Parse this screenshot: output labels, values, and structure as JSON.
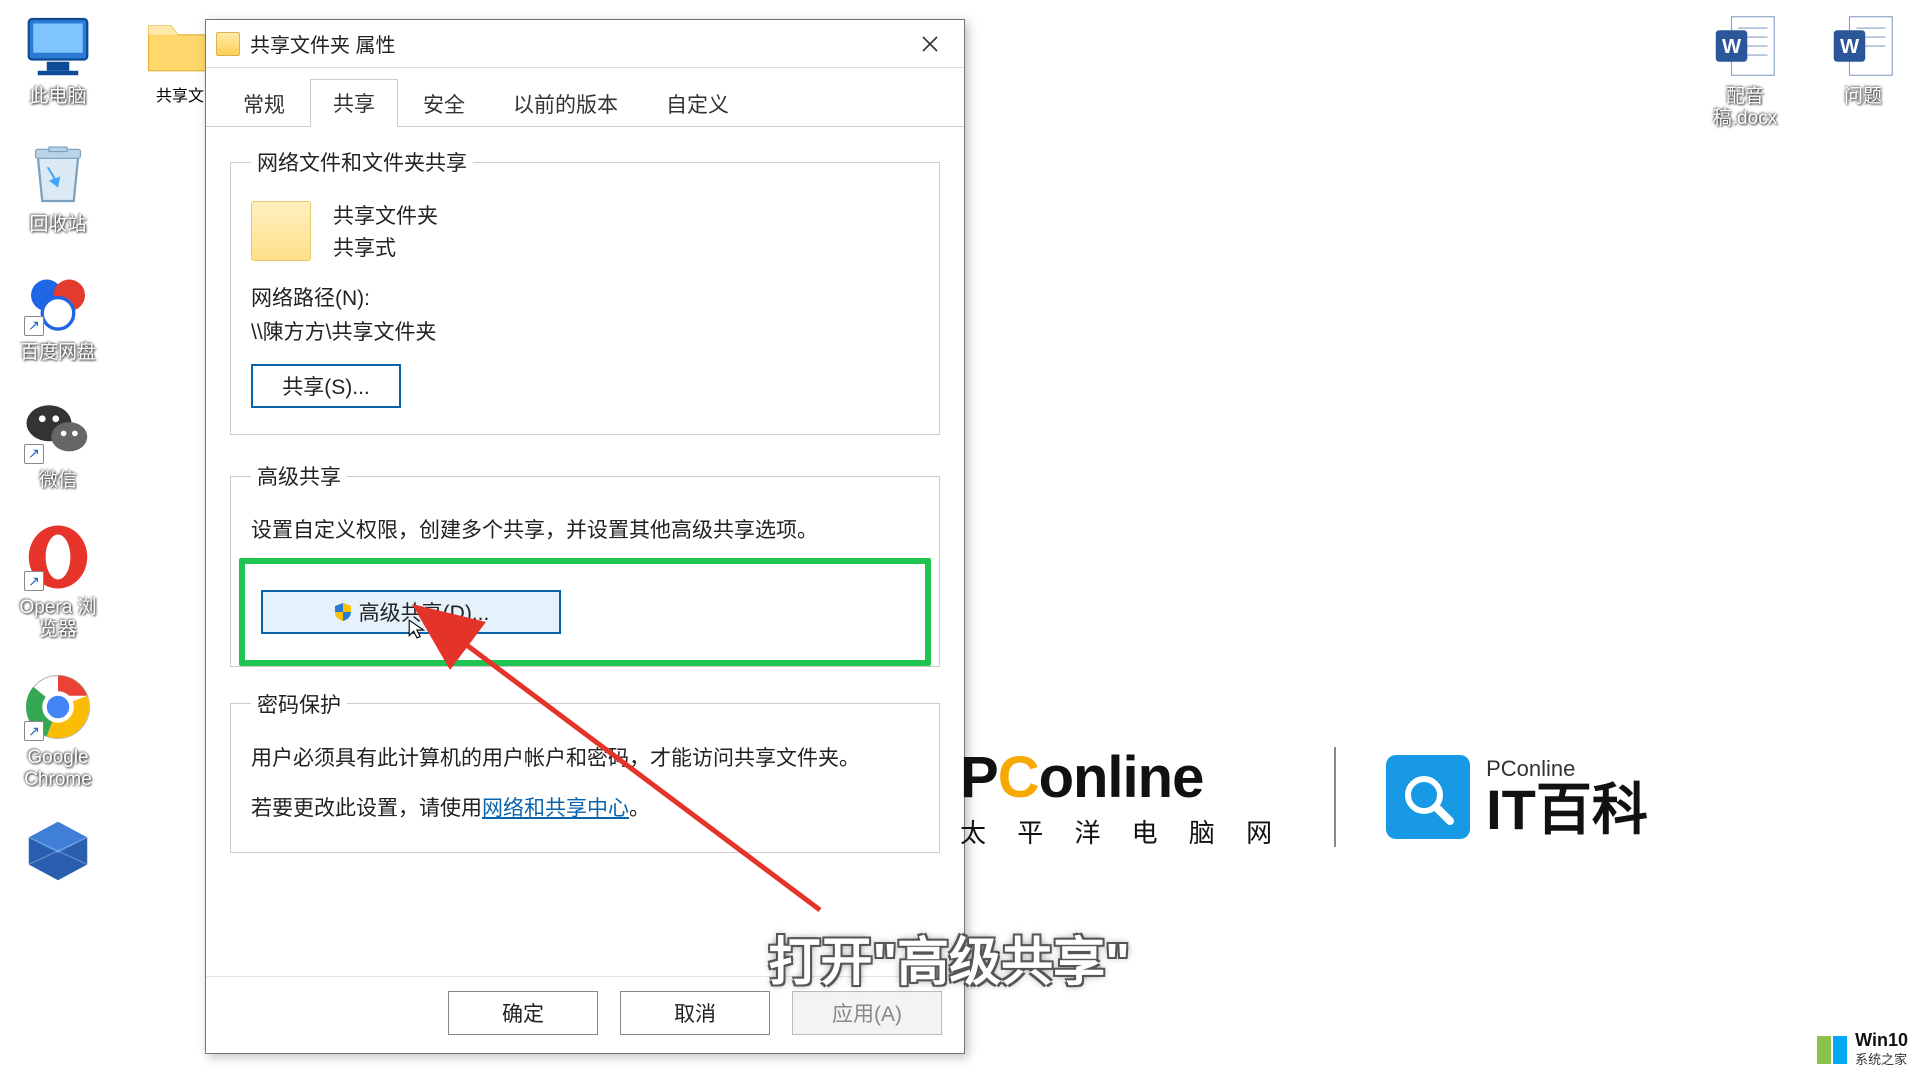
{
  "desktop": {
    "left": [
      {
        "key": "this-pc",
        "label": "此电脑"
      },
      {
        "key": "recycle-bin",
        "label": "回收站"
      },
      {
        "key": "baidu-netdisk",
        "label": "百度网盘"
      },
      {
        "key": "wechat",
        "label": "微信"
      },
      {
        "key": "opera",
        "label": "Opera 浏览器"
      },
      {
        "key": "chrome",
        "label": "Google Chrome"
      }
    ],
    "behind_dialog": {
      "key": "shared-folder",
      "label": "共享文"
    },
    "right": [
      {
        "key": "word-doc-1",
        "label": "配音稿.docx"
      },
      {
        "key": "word-doc-2",
        "label": "问题"
      }
    ]
  },
  "dialog": {
    "title": "共享文件夹 属性",
    "tabs": [
      "常规",
      "共享",
      "安全",
      "以前的版本",
      "自定义"
    ],
    "active_tab_index": 1,
    "section_network": {
      "legend": "网络文件和文件夹共享",
      "folder_name": "共享文件夹",
      "shared_status": "共享式",
      "netpath_label": "网络路径(N):",
      "netpath_value": "\\\\陳方方\\共享文件夹",
      "share_button": "共享(S)..."
    },
    "section_advanced": {
      "legend": "高级共享",
      "desc": "设置自定义权限，创建多个共享，并设置其他高级共享选项。",
      "adv_button": "高级共享(D)..."
    },
    "section_password": {
      "legend": "密码保护",
      "line1": "用户必须具有此计算机的用户帐户和密码，才能访问共享文件夹。",
      "line2_prefix": "若要更改此设置，请使用",
      "link": "网络和共享中心",
      "line2_suffix": "。"
    },
    "footer": {
      "ok": "确定",
      "cancel": "取消",
      "apply": "应用(A)"
    }
  },
  "caption": "打开\"高级共享\"",
  "brand": {
    "pconline": "PConline",
    "pconline_sub": "太 平 洋 电 脑 网",
    "itbk_small": "PConline",
    "itbk": "IT百科"
  },
  "win10": {
    "l1": "Win10",
    "l2": "系统之家"
  }
}
